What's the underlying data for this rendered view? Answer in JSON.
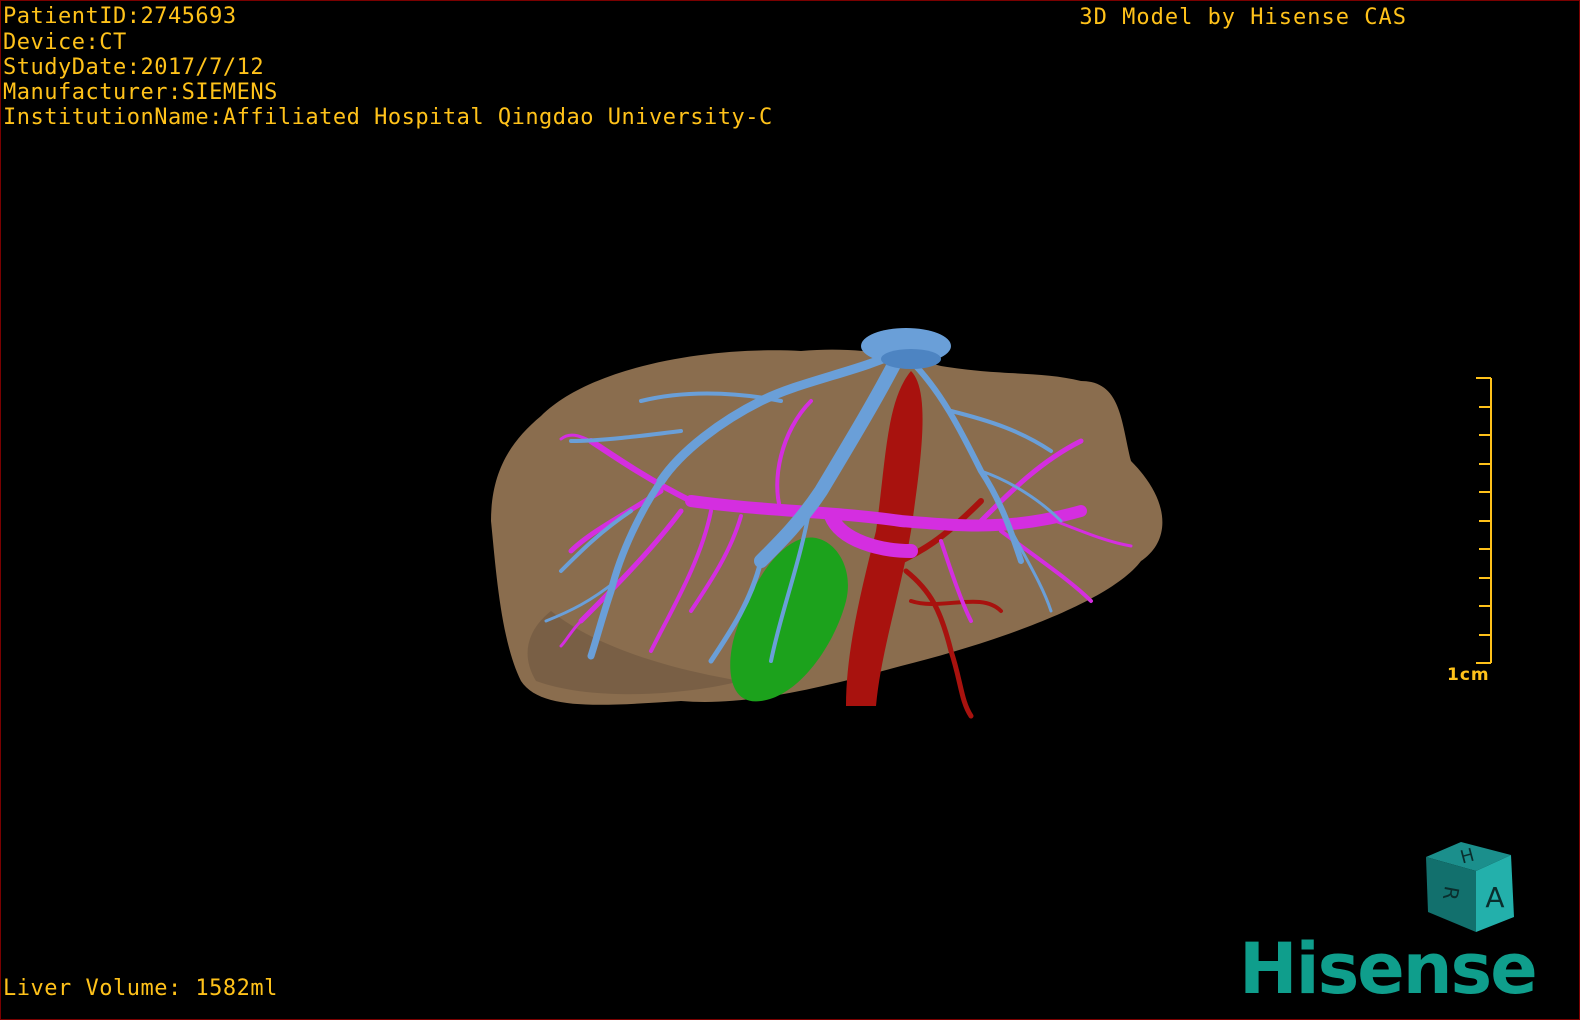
{
  "overlay": {
    "patient_id": "PatientID:2745693",
    "device": "Device:CT",
    "study_date": "StudyDate:2017/7/12",
    "manufacturer": "Manufacturer:SIEMENS",
    "institution": "InstitutionName:Affiliated Hospital Qingdao University-C",
    "credit": "3D Model by Hisense CAS",
    "liver_volume": "Liver Volume: 1582ml"
  },
  "scale_bar": {
    "label": "1cm"
  },
  "orientation_cube": {
    "top_face": "H",
    "left_face": "R",
    "front_face": "A"
  },
  "brand": {
    "logo_text": "Hisense"
  },
  "colors": {
    "overlay_text": "#ffc21a",
    "liver": "#8a6d4e",
    "hepatic_vein": "#6a9fd8",
    "portal_vein": "#d42ee0",
    "artery_ivc": "#a8120e",
    "gallbladder": "#1ca21c",
    "brand": "#0f9e8c"
  }
}
